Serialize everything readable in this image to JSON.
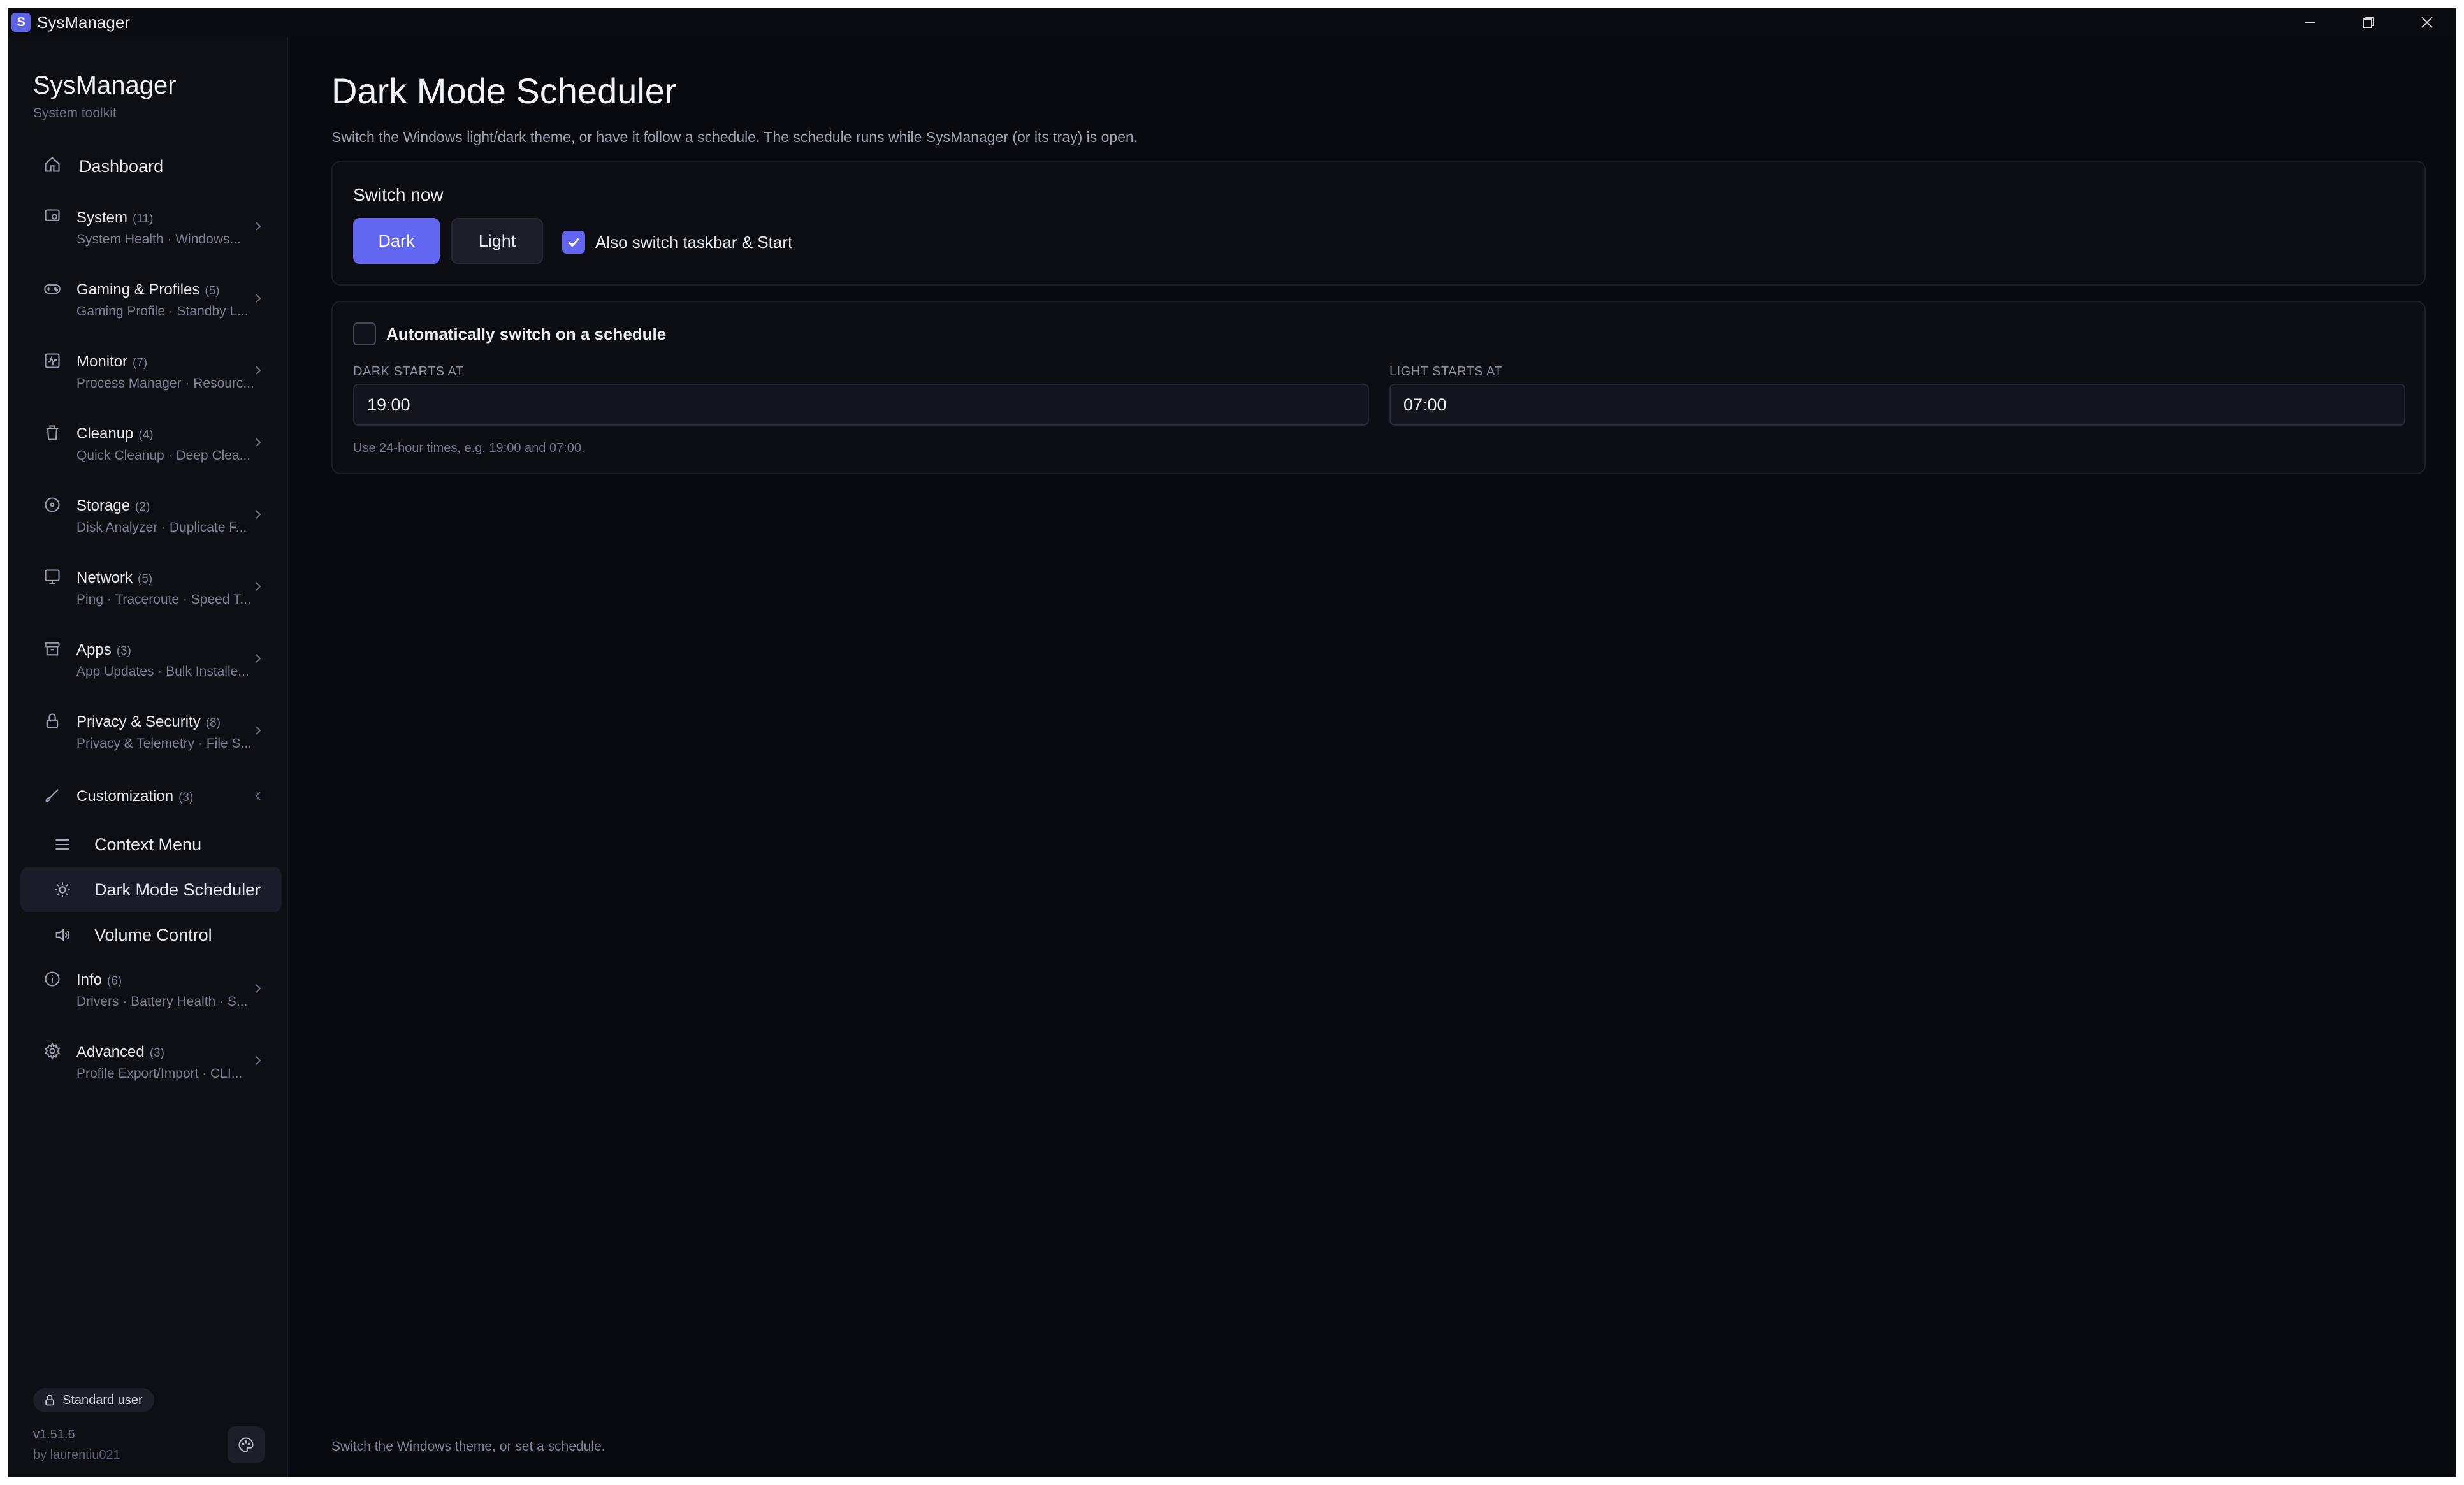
{
  "window": {
    "title": "SysManager",
    "icon_letter": "S",
    "accent": "#6366f1"
  },
  "sidebar": {
    "brand": "SysManager",
    "brand_sub": "System toolkit",
    "dashboard": {
      "label": "Dashboard",
      "icon": "home-icon"
    },
    "items": [
      {
        "title": "System",
        "count": "(11)",
        "sub": "System Health · Windows...",
        "icon": "system-icon"
      },
      {
        "title": "Gaming & Profiles",
        "count": "(5)",
        "sub": "Gaming Profile · Standby L...",
        "icon": "gamepad-icon"
      },
      {
        "title": "Monitor",
        "count": "(7)",
        "sub": "Process Manager · Resourc...",
        "icon": "monitor-icon"
      },
      {
        "title": "Cleanup",
        "count": "(4)",
        "sub": "Quick Cleanup · Deep Clea...",
        "icon": "trash-icon"
      },
      {
        "title": "Storage",
        "count": "(2)",
        "sub": "Disk Analyzer · Duplicate F...",
        "icon": "disk-icon"
      },
      {
        "title": "Network",
        "count": "(5)",
        "sub": "Ping · Traceroute · Speed T...",
        "icon": "network-icon"
      },
      {
        "title": "Apps",
        "count": "(3)",
        "sub": "App Updates · Bulk Installe...",
        "icon": "apps-icon"
      },
      {
        "title": "Privacy & Security",
        "count": "(8)",
        "sub": "Privacy & Telemetry · File S...",
        "icon": "lock-icon"
      },
      {
        "title": "Customization",
        "count": "(3)",
        "sub": "",
        "icon": "brush-icon"
      },
      {
        "title": "Info",
        "count": "(6)",
        "sub": "Drivers · Battery Health · S...",
        "icon": "info-icon"
      },
      {
        "title": "Advanced",
        "count": "(3)",
        "sub": "Profile Export/Import · CLI...",
        "icon": "gear-icon"
      }
    ],
    "customization_children": [
      {
        "label": "Context Menu",
        "icon": "menu-lines-icon"
      },
      {
        "label": "Dark Mode Scheduler",
        "icon": "sun-icon",
        "active": true
      },
      {
        "label": "Volume Control",
        "icon": "speaker-icon"
      }
    ],
    "user_badge": "Standard user",
    "version": "v1.51.6",
    "author": "by laurentiu021"
  },
  "main": {
    "title": "Dark Mode Scheduler",
    "description": "Switch the Windows light/dark theme, or have it follow a schedule. The schedule runs while SysManager (or its tray) is open.",
    "switch_now": {
      "title": "Switch now",
      "dark_label": "Dark",
      "light_label": "Light",
      "taskbar_label": "Also switch taskbar & Start",
      "taskbar_checked": true
    },
    "schedule": {
      "auto_label": "Automatically switch on a schedule",
      "auto_checked": false,
      "dark_starts_label": "DARK STARTS AT",
      "dark_starts_value": "19:00",
      "light_starts_label": "LIGHT STARTS AT",
      "light_starts_value": "07:00",
      "hint": "Use 24-hour times, e.g. 19:00 and 07:00."
    },
    "footer": "Switch the Windows theme, or set a schedule."
  }
}
